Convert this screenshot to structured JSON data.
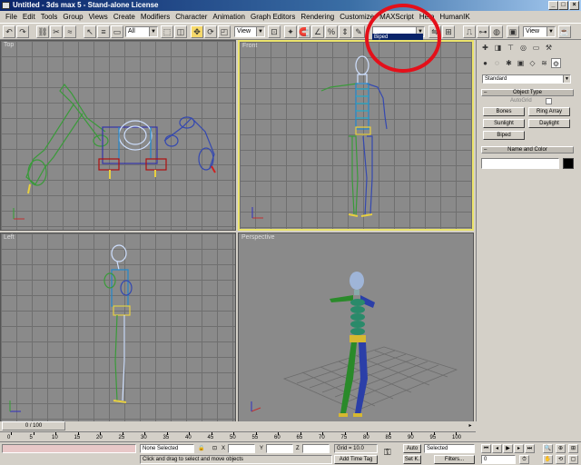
{
  "window": {
    "title": "Untitled - 3ds max 5 - Stand-alone License"
  },
  "menu": [
    "File",
    "Edit",
    "Tools",
    "Group",
    "Views",
    "Create",
    "Modifiers",
    "Character",
    "Animation",
    "Graph Editors",
    "Rendering",
    "Customize",
    "MAXScript",
    "Help",
    "HumanIK"
  ],
  "toolbar": {
    "selection_filter": "All",
    "ref_coord": "View",
    "named_set_value": "",
    "named_set_dropdown_item": "Biped",
    "render_type": "View"
  },
  "viewports": {
    "top": "Top",
    "front": "Front",
    "left": "Left",
    "perspective": "Perspective",
    "active": "front"
  },
  "command_panel": {
    "category": "Standard",
    "object_type_title": "Object Type",
    "autogrid": "AutoGrid",
    "buttons": [
      "Bones",
      "Ring Array",
      "Sunlight",
      "Daylight",
      "Biped"
    ],
    "name_color_title": "Name and Color",
    "object_color": "#000000"
  },
  "time": {
    "slider_label": "0 / 100",
    "ticks": [
      "0",
      "5",
      "10",
      "15",
      "20",
      "25",
      "30",
      "35",
      "40",
      "45",
      "50",
      "55",
      "60",
      "65",
      "70",
      "75",
      "80",
      "85",
      "90",
      "95",
      "100"
    ]
  },
  "status": {
    "selection": "None Selected",
    "prompt": "Click and drag to select and move objects",
    "x_label": "X",
    "y_label": "Y",
    "z_label": "Z",
    "grid": "Grid = 10.0",
    "add_time_tag": "Add Time Tag",
    "auto_key": "Auto",
    "set_key": "Set K.",
    "key_mode": "Selected",
    "filters": "Filters...",
    "frame": "0"
  },
  "colors": {
    "highlight_circle": "#e4101a",
    "active_viewport_border": "#ebe36b",
    "titlebar": "#0a246a"
  }
}
